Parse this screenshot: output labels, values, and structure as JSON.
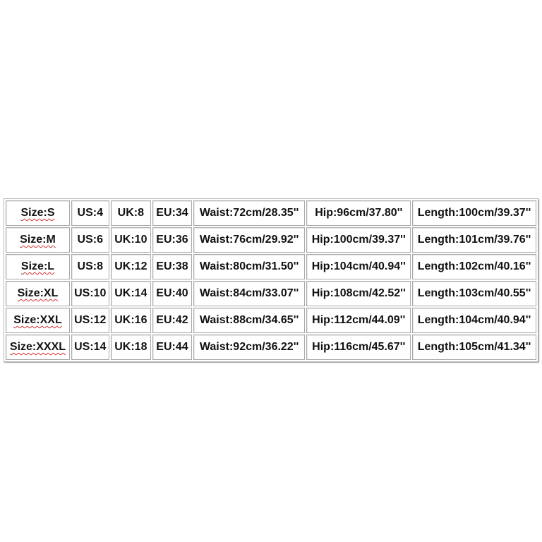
{
  "size_chart": {
    "rows": [
      [
        "Size:S",
        "US:4",
        "UK:8",
        "EU:34",
        "Waist:72cm/28.35''",
        "Hip:96cm/37.80''",
        "Length:100cm/39.37''"
      ],
      [
        "Size:M",
        "US:6",
        "UK:10",
        "EU:36",
        "Waist:76cm/29.92''",
        "Hip:100cm/39.37''",
        "Length:101cm/39.76''"
      ],
      [
        "Size:L",
        "US:8",
        "UK:12",
        "EU:38",
        "Waist:80cm/31.50''",
        "Hip:104cm/40.94''",
        "Length:102cm/40.16''"
      ],
      [
        "Size:XL",
        "US:10",
        "UK:14",
        "EU:40",
        "Waist:84cm/33.07''",
        "Hip:108cm/42.52''",
        "Length:103cm/40.55''"
      ],
      [
        "Size:XXL",
        "US:12",
        "UK:16",
        "EU:42",
        "Waist:88cm/34.65''",
        "Hip:112cm/44.09''",
        "Length:104cm/40.94''"
      ],
      [
        "Size:XXXL",
        "US:14",
        "UK:18",
        "EU:44",
        "Waist:92cm/36.22''",
        "Hip:116cm/45.67''",
        "Length:105cm/41.34''"
      ]
    ]
  }
}
